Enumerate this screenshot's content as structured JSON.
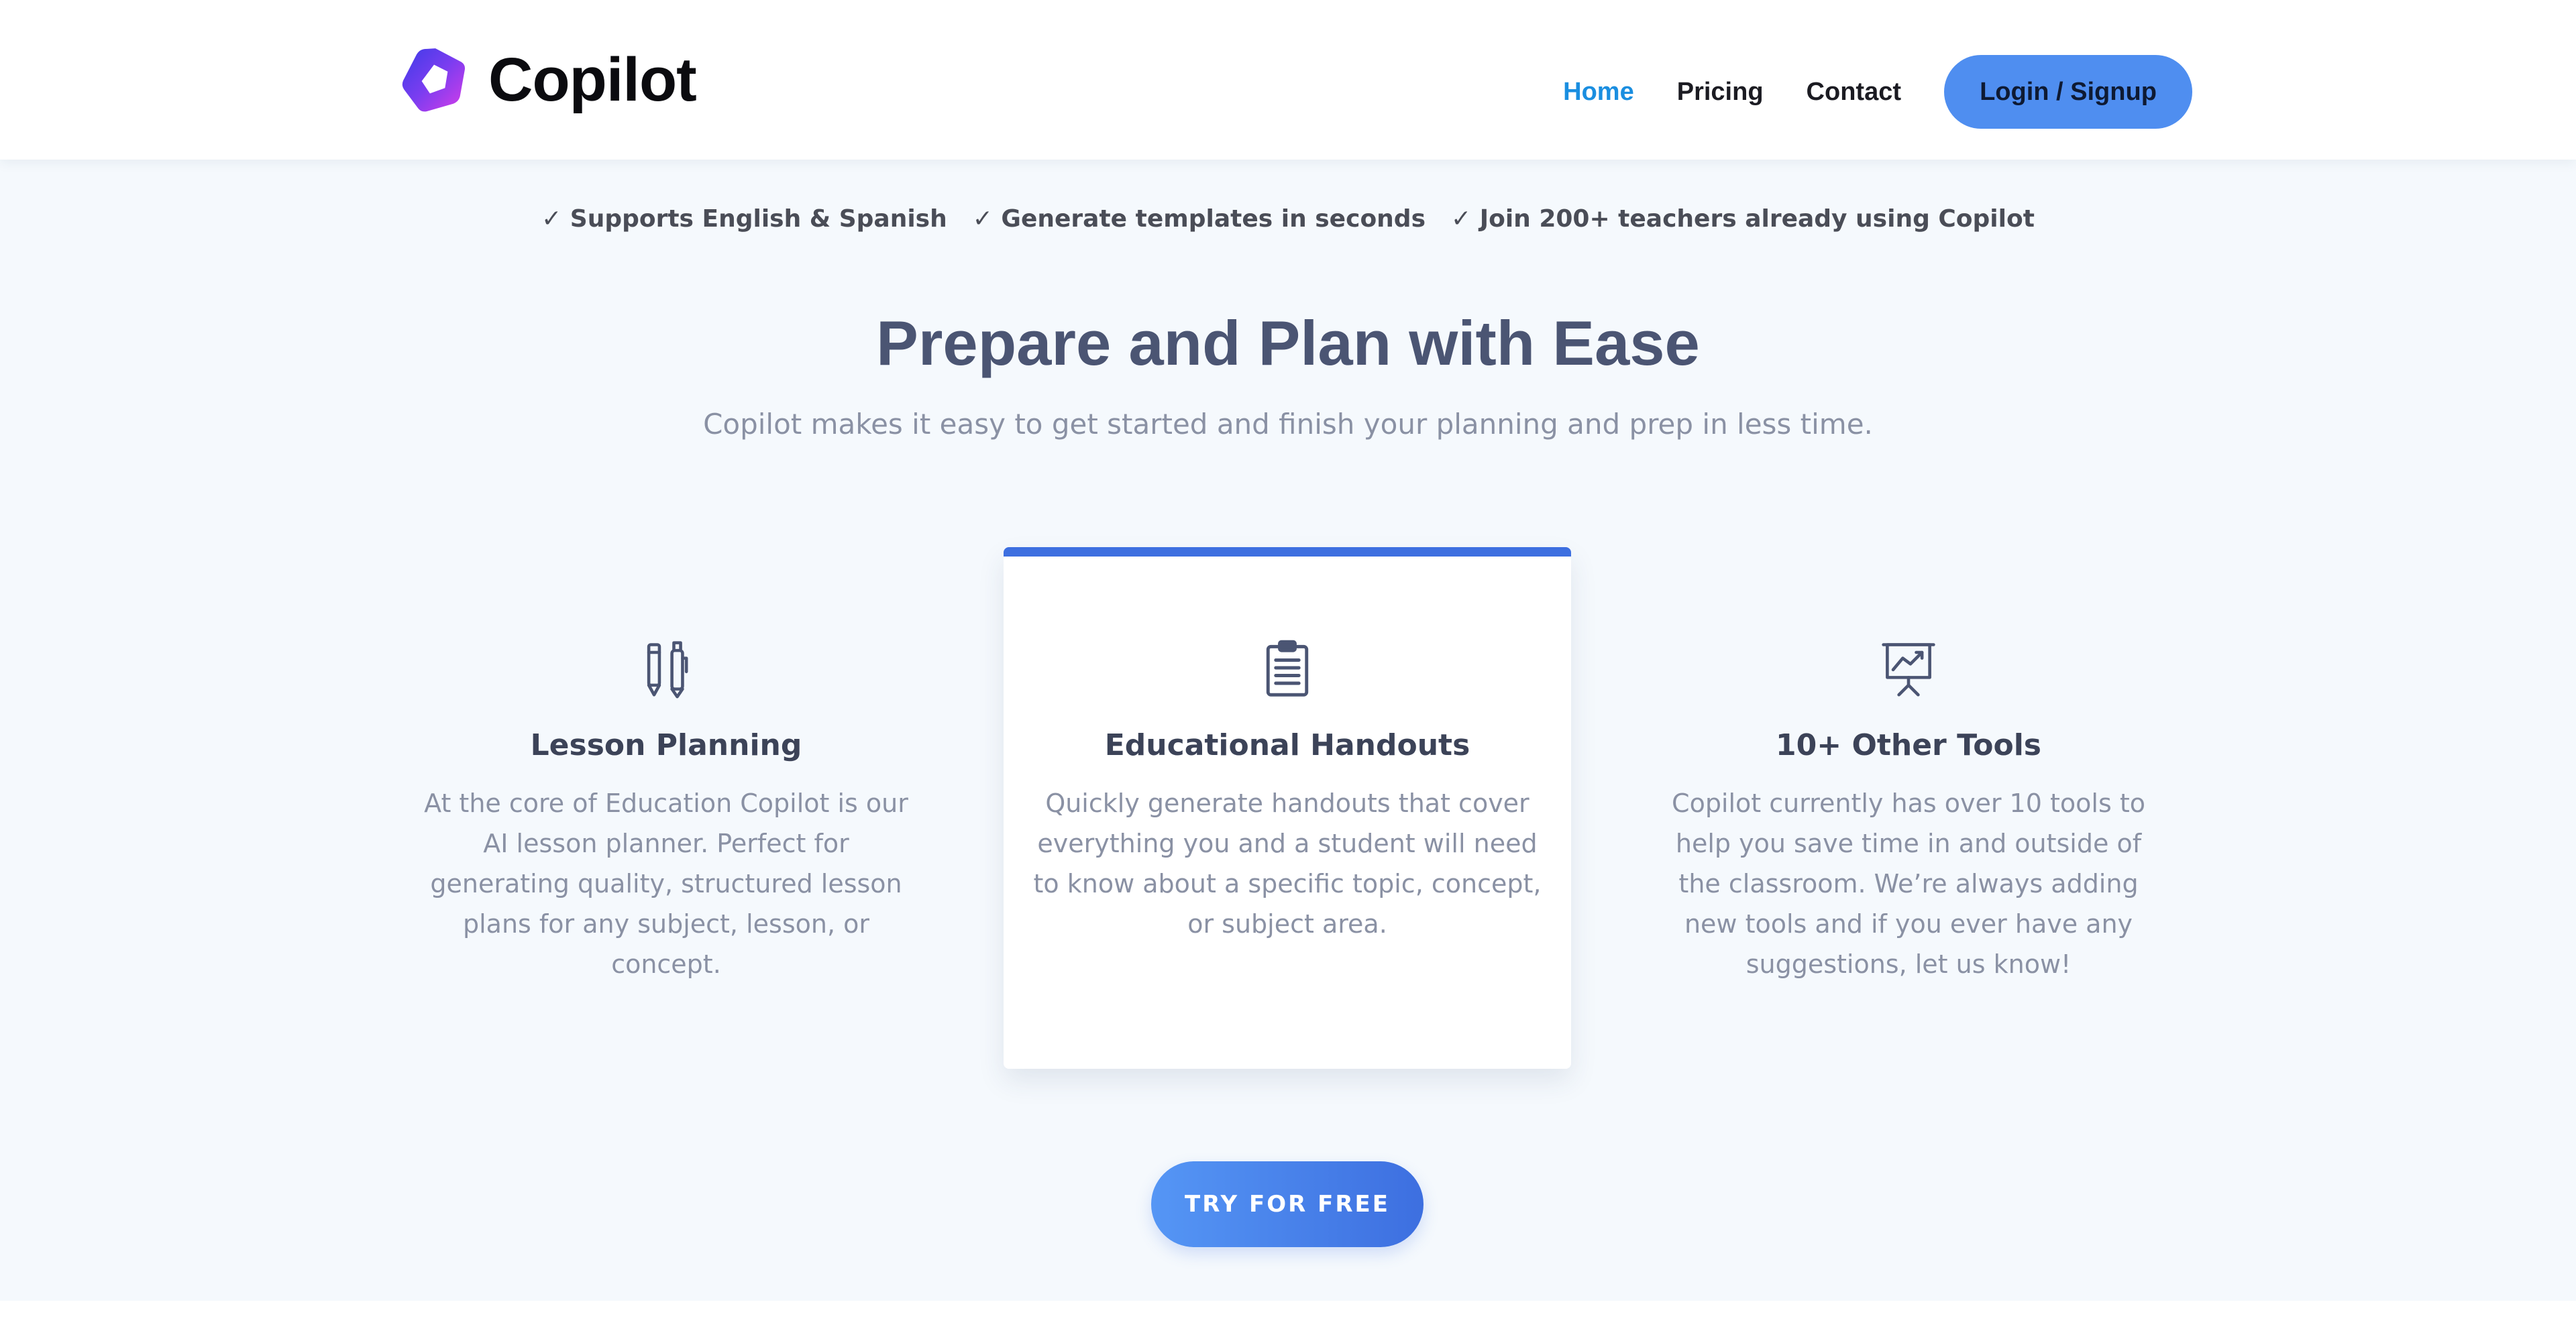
{
  "brand": {
    "name": "Copilot"
  },
  "nav": {
    "items": [
      {
        "label": "Home",
        "active": true
      },
      {
        "label": "Pricing",
        "active": false
      },
      {
        "label": "Contact",
        "active": false
      }
    ],
    "login_label": "Login / Signup"
  },
  "hero": {
    "features": [
      "✓ Supports English & Spanish",
      "✓ Generate templates in seconds",
      "✓ Join 200+ teachers already using Copilot"
    ],
    "title": "Prepare and Plan with Ease",
    "subtitle": "Copilot makes it easy to get started and finish your planning and prep in less time."
  },
  "cards": [
    {
      "icon": "pencil-pen-icon",
      "title": "Lesson Planning",
      "body": "At the core of Education Copilot is our AI lesson planner. Perfect for generating quality, structured lesson plans for any subject, lesson, or concept."
    },
    {
      "icon": "clipboard-icon",
      "title": "Educational Handouts",
      "body": "Quickly generate handouts that cover everything you and a student will need to know about a specific topic, concept, or subject area."
    },
    {
      "icon": "presentation-chart-icon",
      "title": "10+ Other Tools",
      "body": "Copilot currently has over 10 tools to help you save time in and outside of the classroom. We’re always adding new tools and if you ever have any suggestions, let us know!"
    }
  ],
  "cta": {
    "label": "TRY FOR FREE"
  },
  "colors": {
    "accent": "#3d6fe0",
    "nav_active": "#1a8ee0",
    "button": "#4f8ef0",
    "hero_bg": "#f5f9fd",
    "title": "#4b5573",
    "muted": "#8a91a4"
  }
}
